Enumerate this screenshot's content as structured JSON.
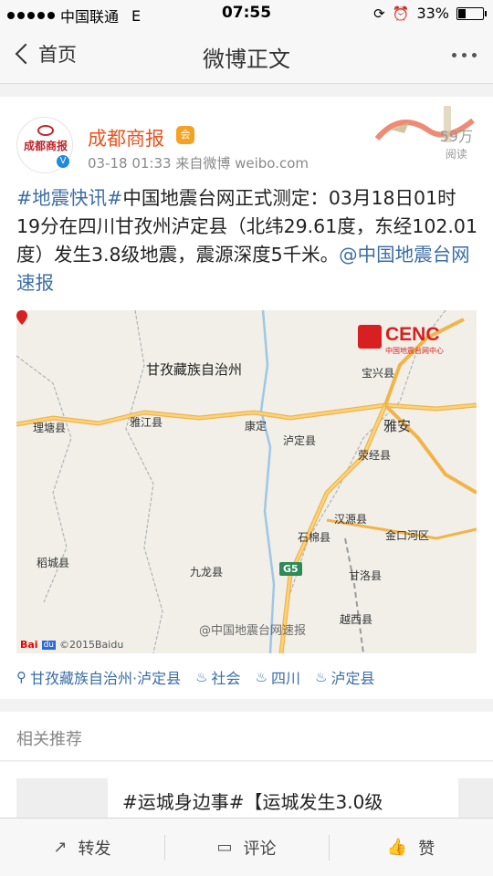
{
  "status_bar": {
    "carrier": "中国联通",
    "network": "E",
    "time": "07:55",
    "battery": "33%",
    "battery_level": 0.33
  },
  "nav": {
    "back_label": "首页",
    "title": "微博正文",
    "more_icon": "more-icon"
  },
  "post": {
    "avatar_text": "成都商报",
    "author": "成都商报",
    "meta": "03-18 01:33  来自微博 weibo.com",
    "reads_count": "59万",
    "reads_label": "阅读",
    "text_hashtag": "#地震快讯#",
    "text_body": "中国地震台网正式测定：03月18日01时19分在四川甘孜州泸定县（北纬29.61度，东经102.01度）发生3.8级地震，震源深度5千米。",
    "text_mention": "@中国地震台网速报",
    "map": {
      "cenc_name": "CENC",
      "cenc_sub": "中国地震台网中心",
      "labels": {
        "ganzi": "甘孜藏族自治州",
        "baoxing": "宝兴县",
        "litang": "理塘县",
        "yajiang": "雅江县",
        "kangding": "康定",
        "luding": "泸定县",
        "yaan": "雅安",
        "yingjing": "荥经县",
        "hanyuan": "汉源县",
        "shimian": "石棉县",
        "jinkouhe": "金口河区",
        "daocheng": "稻城县",
        "jiulong": "九龙县",
        "ganluo": "甘洛县",
        "yuexi": "越西县"
      },
      "highway": "G5",
      "baidu_copyright": "©2015Baidu",
      "watermark": "@中国地震台网速报"
    },
    "tags": [
      {
        "icon": "location-icon",
        "label": "甘孜藏族自治州·泸定县"
      },
      {
        "icon": "flame-icon",
        "label": "社会"
      },
      {
        "icon": "flame-icon",
        "label": "四川"
      },
      {
        "icon": "flame-icon",
        "label": "泸定县"
      }
    ]
  },
  "related": {
    "header": "相关推荐",
    "item_text": "#运城身边事#【运城发生3.0级"
  },
  "toolbar": {
    "repost": "转发",
    "comment": "评论",
    "like": "赞"
  }
}
